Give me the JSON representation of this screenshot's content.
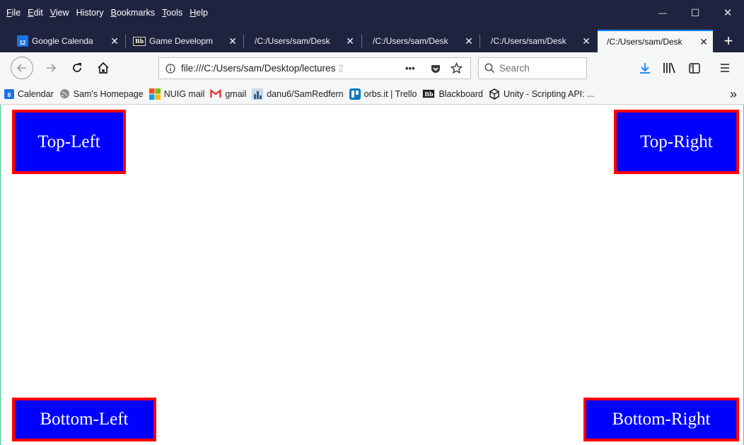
{
  "menubar": {
    "items": [
      {
        "first": "F",
        "rest": "ile"
      },
      {
        "first": "E",
        "rest": "dit"
      },
      {
        "first": "V",
        "rest": "iew"
      },
      {
        "first": "Hi",
        "rest": "story",
        "underline_index": 2
      },
      {
        "first": "B",
        "rest": "ookmarks"
      },
      {
        "first": "T",
        "rest": "ools"
      },
      {
        "first": "H",
        "rest": "elp"
      }
    ],
    "window_controls": {
      "minimize": "—",
      "maximize": "☐",
      "close": "✕"
    }
  },
  "tabs": [
    {
      "icon": "calendar-icon",
      "icon_text": "12",
      "title": "Google Calenda",
      "close": "✕"
    },
    {
      "icon": "blackboard-icon",
      "icon_text": "Bb",
      "title": "Game Developm",
      "close": "✕"
    },
    {
      "title": "/C:/Users/sam/Desk",
      "close": "✕"
    },
    {
      "title": "/C:/Users/sam/Desk",
      "close": "✕"
    },
    {
      "title": "/C:/Users/sam/Desk",
      "close": "✕"
    },
    {
      "title": "/C:/Users/sam/Desk",
      "close": "✕",
      "active": true
    }
  ],
  "new_tab": "+",
  "nav": {
    "url": "file:///C:/Users/sam/Desktop/lectures",
    "url_faded": " 2",
    "search_placeholder": "Search",
    "page_actions": "•••"
  },
  "bookmarks": [
    {
      "icon": "calendar-icon",
      "icon_text": "8",
      "label": "Calendar"
    },
    {
      "icon": "globe-icon",
      "label": "Sam's Homepage"
    },
    {
      "icon": "microsoft-icon",
      "label": "NUIG mail"
    },
    {
      "icon": "gmail-icon",
      "label": "gmail"
    },
    {
      "icon": "github-icon",
      "label": "danu6/SamRedfern"
    },
    {
      "icon": "trello-icon",
      "label": "orbs.it | Trello"
    },
    {
      "icon": "blackboard-icon",
      "icon_text": "Bb",
      "label": "Blackboard"
    },
    {
      "icon": "unity-icon",
      "label": "Unity - Scripting API: ..."
    }
  ],
  "bookmarks_more": "»",
  "content": {
    "top_left": "Top-Left",
    "top_right": "Top-Right",
    "bottom_left": "Bottom-Left",
    "bottom_right": "Bottom-Right"
  },
  "colors": {
    "chrome_dark": "#202340",
    "box_fill": "#0000ff",
    "box_border": "#ff0000",
    "accent": "#0a84ff"
  }
}
